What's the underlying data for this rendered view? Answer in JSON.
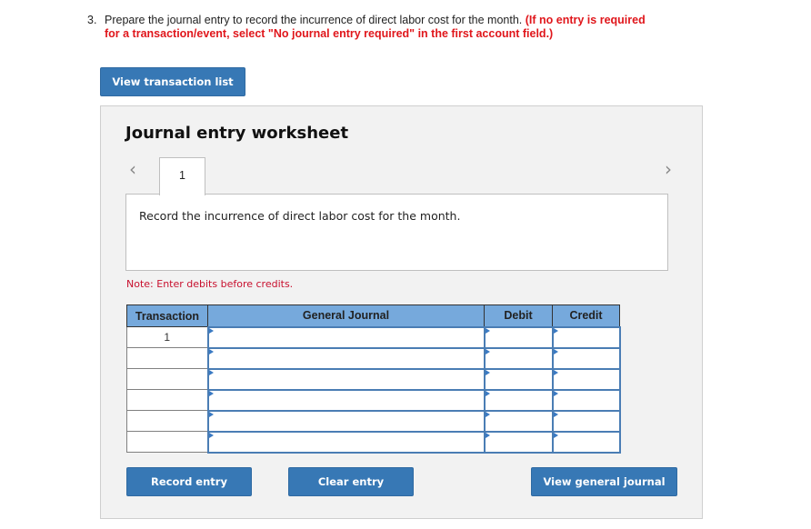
{
  "question": {
    "number": "3.",
    "text": "Prepare the journal entry to record the incurrence of direct labor cost for the month. ",
    "instruction": "(If no entry is required for a transaction/event, select \"No journal entry required\" in the first account field.)"
  },
  "buttons": {
    "view_transaction_list": "View transaction list",
    "record_entry": "Record entry",
    "clear_entry": "Clear entry",
    "view_general_journal": "View general journal"
  },
  "worksheet": {
    "title": "Journal entry worksheet",
    "prev_icon": "chevron-left-icon",
    "next_icon": "chevron-right-icon",
    "active_tab": "1",
    "description": "Record the incurrence of direct labor cost for the month.",
    "note": "Note: Enter debits before credits."
  },
  "table": {
    "headers": [
      "Transaction",
      "General Journal",
      "Debit",
      "Credit"
    ],
    "rows": [
      {
        "transaction": "1",
        "account": "",
        "debit": "",
        "credit": ""
      },
      {
        "transaction": "",
        "account": "",
        "debit": "",
        "credit": ""
      },
      {
        "transaction": "",
        "account": "",
        "debit": "",
        "credit": ""
      },
      {
        "transaction": "",
        "account": "",
        "debit": "",
        "credit": ""
      },
      {
        "transaction": "",
        "account": "",
        "debit": "",
        "credit": ""
      },
      {
        "transaction": "",
        "account": "",
        "debit": "",
        "credit": ""
      }
    ]
  },
  "colors": {
    "button_blue": "#3778b5",
    "header_blue": "#76a9dc",
    "instruction_red": "#e0161b",
    "note_red": "#c8102e"
  }
}
